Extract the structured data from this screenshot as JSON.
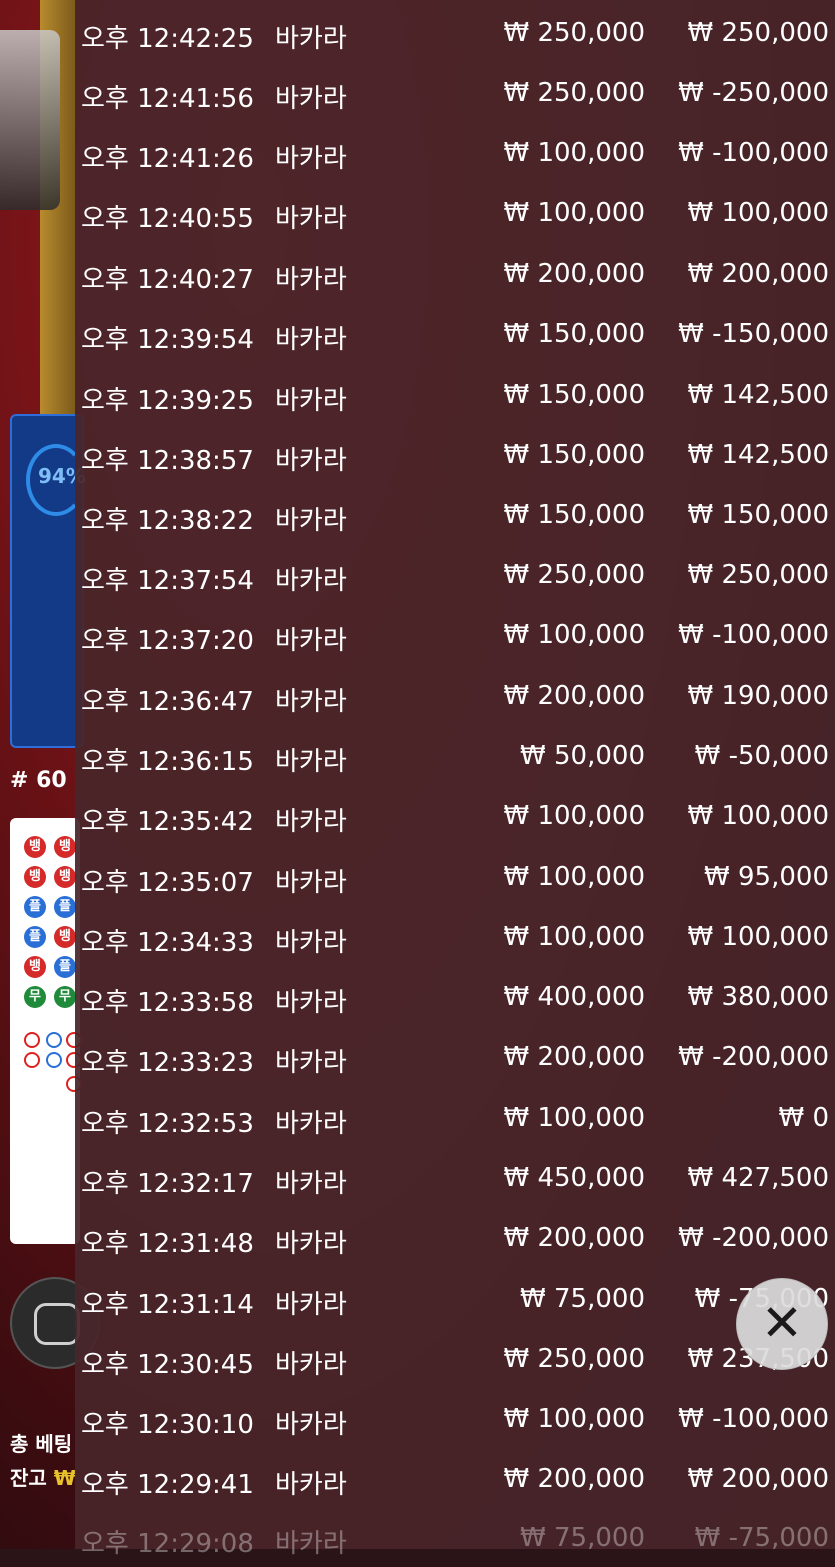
{
  "background": {
    "progress_label": "94%",
    "round_label": "# 60",
    "road_labels": [
      "뱅",
      "뱅",
      "뱅",
      "뱅",
      "플",
      "플",
      "플",
      "뱅",
      "뱅",
      "플",
      "무",
      "무"
    ],
    "footer": {
      "total_bet_label": "총 베팅",
      "balance_label": "잔고",
      "currency_symbol": "₩"
    }
  },
  "history": {
    "currency": "₩",
    "rows": [
      {
        "time": "오후 12:42:25",
        "game": "바카라",
        "bet": "₩ 250,000",
        "result": "₩ 250,000"
      },
      {
        "time": "오후 12:41:56",
        "game": "바카라",
        "bet": "₩ 250,000",
        "result": "₩ -250,000"
      },
      {
        "time": "오후 12:41:26",
        "game": "바카라",
        "bet": "₩ 100,000",
        "result": "₩ -100,000"
      },
      {
        "time": "오후 12:40:55",
        "game": "바카라",
        "bet": "₩ 100,000",
        "result": "₩ 100,000"
      },
      {
        "time": "오후 12:40:27",
        "game": "바카라",
        "bet": "₩ 200,000",
        "result": "₩ 200,000"
      },
      {
        "time": "오후 12:39:54",
        "game": "바카라",
        "bet": "₩ 150,000",
        "result": "₩ -150,000"
      },
      {
        "time": "오후 12:39:25",
        "game": "바카라",
        "bet": "₩ 150,000",
        "result": "₩ 142,500"
      },
      {
        "time": "오후 12:38:57",
        "game": "바카라",
        "bet": "₩ 150,000",
        "result": "₩ 142,500"
      },
      {
        "time": "오후 12:38:22",
        "game": "바카라",
        "bet": "₩ 150,000",
        "result": "₩ 150,000"
      },
      {
        "time": "오후 12:37:54",
        "game": "바카라",
        "bet": "₩ 250,000",
        "result": "₩ 250,000"
      },
      {
        "time": "오후 12:37:20",
        "game": "바카라",
        "bet": "₩ 100,000",
        "result": "₩ -100,000"
      },
      {
        "time": "오후 12:36:47",
        "game": "바카라",
        "bet": "₩ 200,000",
        "result": "₩ 190,000"
      },
      {
        "time": "오후 12:36:15",
        "game": "바카라",
        "bet": "₩ 50,000",
        "result": "₩ -50,000"
      },
      {
        "time": "오후 12:35:42",
        "game": "바카라",
        "bet": "₩ 100,000",
        "result": "₩ 100,000"
      },
      {
        "time": "오후 12:35:07",
        "game": "바카라",
        "bet": "₩ 100,000",
        "result": "₩ 95,000"
      },
      {
        "time": "오후 12:34:33",
        "game": "바카라",
        "bet": "₩ 100,000",
        "result": "₩ 100,000"
      },
      {
        "time": "오후 12:33:58",
        "game": "바카라",
        "bet": "₩ 400,000",
        "result": "₩ 380,000"
      },
      {
        "time": "오후 12:33:23",
        "game": "바카라",
        "bet": "₩ 200,000",
        "result": "₩ -200,000"
      },
      {
        "time": "오후 12:32:53",
        "game": "바카라",
        "bet": "₩ 100,000",
        "result": "₩ 0"
      },
      {
        "time": "오후 12:32:17",
        "game": "바카라",
        "bet": "₩ 450,000",
        "result": "₩ 427,500"
      },
      {
        "time": "오후 12:31:48",
        "game": "바카라",
        "bet": "₩ 200,000",
        "result": "₩ -200,000"
      },
      {
        "time": "오후 12:31:14",
        "game": "바카라",
        "bet": "₩ 75,000",
        "result": "₩ -75,000"
      },
      {
        "time": "오후 12:30:45",
        "game": "바카라",
        "bet": "₩ 250,000",
        "result": "₩ 237,500"
      },
      {
        "time": "오후 12:30:10",
        "game": "바카라",
        "bet": "₩ 100,000",
        "result": "₩ -100,000"
      },
      {
        "time": "오후 12:29:41",
        "game": "바카라",
        "bet": "₩ 200,000",
        "result": "₩ 200,000"
      },
      {
        "time": "오후 12:29:08",
        "game": "바카라",
        "bet": "₩ 75,000",
        "result": "₩ -75,000"
      }
    ]
  },
  "close_button": {
    "icon": "close-icon",
    "glyph": "✕"
  },
  "colors": {
    "overlay": "#48262a",
    "banker": "#d42a2a",
    "player": "#2a6fd6",
    "tie": "#1f8a3a",
    "balance_accent": "#e8c22a"
  }
}
